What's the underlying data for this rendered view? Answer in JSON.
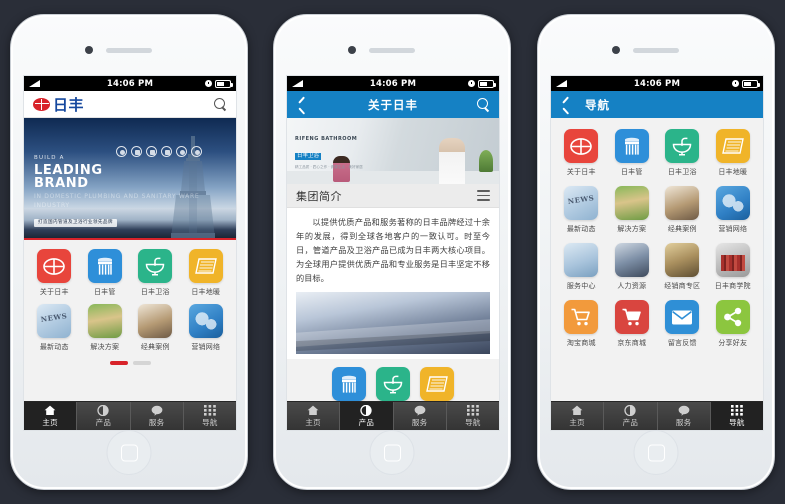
{
  "statusbar": {
    "time": "14:06 PM"
  },
  "colors": {
    "brand_red": "#d8232a",
    "brand_blue": "#15489e",
    "header_blue": "#1581c4",
    "tile_red": "#e8453c",
    "tile_blue": "#2e8fd9",
    "tile_green": "#2bb48a",
    "tile_amber": "#f0b429",
    "tile_orange": "#f29a3c",
    "tile_crimson": "#d9453f",
    "tile_skyblue": "#2f8fd6",
    "tile_lime": "#8cc63f",
    "background": "#2a2e38"
  },
  "tabbar": {
    "items": [
      {
        "label": "主页",
        "icon": "home-icon"
      },
      {
        "label": "产品",
        "icon": "product-icon"
      },
      {
        "label": "服务",
        "icon": "service-icon"
      },
      {
        "label": "导航",
        "icon": "grid-icon"
      }
    ]
  },
  "phone1": {
    "logo": {
      "text": "日丰",
      "mark": "rifeng-logo-mark"
    },
    "search_icon": "search-icon",
    "banner": {
      "line_small": "BUILD A",
      "line_big_1": "LEADING",
      "line_big_2": "BRAND",
      "line_faint": "IN DOMESTIC PLUMBING AND SANITARY WARE INDUSTRY",
      "tag": "打造国内管道及卫浴行业领先品牌"
    },
    "grid": [
      {
        "label": "关于日丰",
        "icon": "rifeng-logo-icon",
        "style": "flat",
        "color": "tile_red"
      },
      {
        "label": "日丰管",
        "icon": "pipes-icon",
        "style": "flat",
        "color": "tile_blue"
      },
      {
        "label": "日丰卫浴",
        "icon": "sink-icon",
        "style": "flat",
        "color": "tile_green"
      },
      {
        "label": "日丰地暖",
        "icon": "floor-heating-icon",
        "style": "flat",
        "color": "tile_amber"
      },
      {
        "label": "最新动态",
        "icon": "news-photo-icon",
        "style": "photo",
        "photo": "ph-news"
      },
      {
        "label": "解决方案",
        "icon": "solution-photo-icon",
        "style": "photo",
        "photo": "ph-plan"
      },
      {
        "label": "经典案例",
        "icon": "case-photo-icon",
        "style": "photo",
        "photo": "ph-case"
      },
      {
        "label": "营销网络",
        "icon": "network-globe-icon",
        "style": "photo",
        "photo": "ph-net"
      }
    ],
    "pager": {
      "pages": 2,
      "active": 0
    }
  },
  "phone2": {
    "header": {
      "title": "关于日丰",
      "back_icon": "back-chevron-icon",
      "search_icon": "search-icon"
    },
    "hero": {
      "brand": "RIFENG BATHROOM",
      "badge": "日丰卫浴",
      "caption": "精工品质 · 匠心之作 · 健康生活 · 美好家居"
    },
    "section": {
      "title": "集团简介",
      "menu_icon": "hamburger-icon"
    },
    "body": "以提供优质产品和服务著称的日丰品牌经过十余年的发展，得到全球各地客户的一致认可。时至今日，管道产品及卫浴产品已成为日丰两大核心项目。为全球用户提供优质产品和专业服务是日丰坚定不移的目标。",
    "mini_grid": [
      {
        "label": "日丰管",
        "icon": "pipes-icon",
        "color": "tile_blue"
      },
      {
        "label": "日丰卫浴",
        "icon": "sink-icon",
        "color": "tile_green"
      },
      {
        "label": "日丰地暖",
        "icon": "floor-heating-icon",
        "color": "tile_amber"
      }
    ],
    "active_tab": 1
  },
  "phone3": {
    "header": {
      "title": "导航",
      "back_icon": "back-chevron-icon"
    },
    "grid": [
      {
        "label": "关于日丰",
        "icon": "rifeng-logo-icon",
        "style": "flat",
        "color": "tile_red"
      },
      {
        "label": "日丰管",
        "icon": "pipes-icon",
        "style": "flat",
        "color": "tile_blue"
      },
      {
        "label": "日丰卫浴",
        "icon": "sink-icon",
        "style": "flat",
        "color": "tile_green"
      },
      {
        "label": "日丰地暖",
        "icon": "floor-heating-icon",
        "style": "flat",
        "color": "tile_amber"
      },
      {
        "label": "最新动态",
        "icon": "news-photo-icon",
        "style": "photo",
        "photo": "ph-news"
      },
      {
        "label": "解决方案",
        "icon": "solution-photo-icon",
        "style": "photo",
        "photo": "ph-plan"
      },
      {
        "label": "经典案例",
        "icon": "case-photo-icon",
        "style": "photo",
        "photo": "ph-case"
      },
      {
        "label": "营销网络",
        "icon": "network-globe-icon",
        "style": "photo",
        "photo": "ph-net"
      },
      {
        "label": "服务中心",
        "icon": "support-agent-photo-icon",
        "style": "photo",
        "photo": "ph-srv"
      },
      {
        "label": "人力资源",
        "icon": "hr-people-photo-icon",
        "style": "photo",
        "photo": "ph-hr"
      },
      {
        "label": "经销商专区",
        "icon": "dealer-photo-icon",
        "style": "photo",
        "photo": "ph-deal"
      },
      {
        "label": "日丰商学院",
        "icon": "books-photo-icon",
        "style": "photo",
        "photo": "ph-edu"
      },
      {
        "label": "淘宝商城",
        "icon": "cart-icon",
        "style": "flat",
        "color": "tile_orange"
      },
      {
        "label": "京东商城",
        "icon": "cart-filled-icon",
        "style": "flat",
        "color": "tile_crimson"
      },
      {
        "label": "留言反馈",
        "icon": "envelope-icon",
        "style": "flat",
        "color": "tile_skyblue"
      },
      {
        "label": "分享好友",
        "icon": "share-icon",
        "style": "flat",
        "color": "tile_lime"
      }
    ],
    "active_tab": 3
  }
}
